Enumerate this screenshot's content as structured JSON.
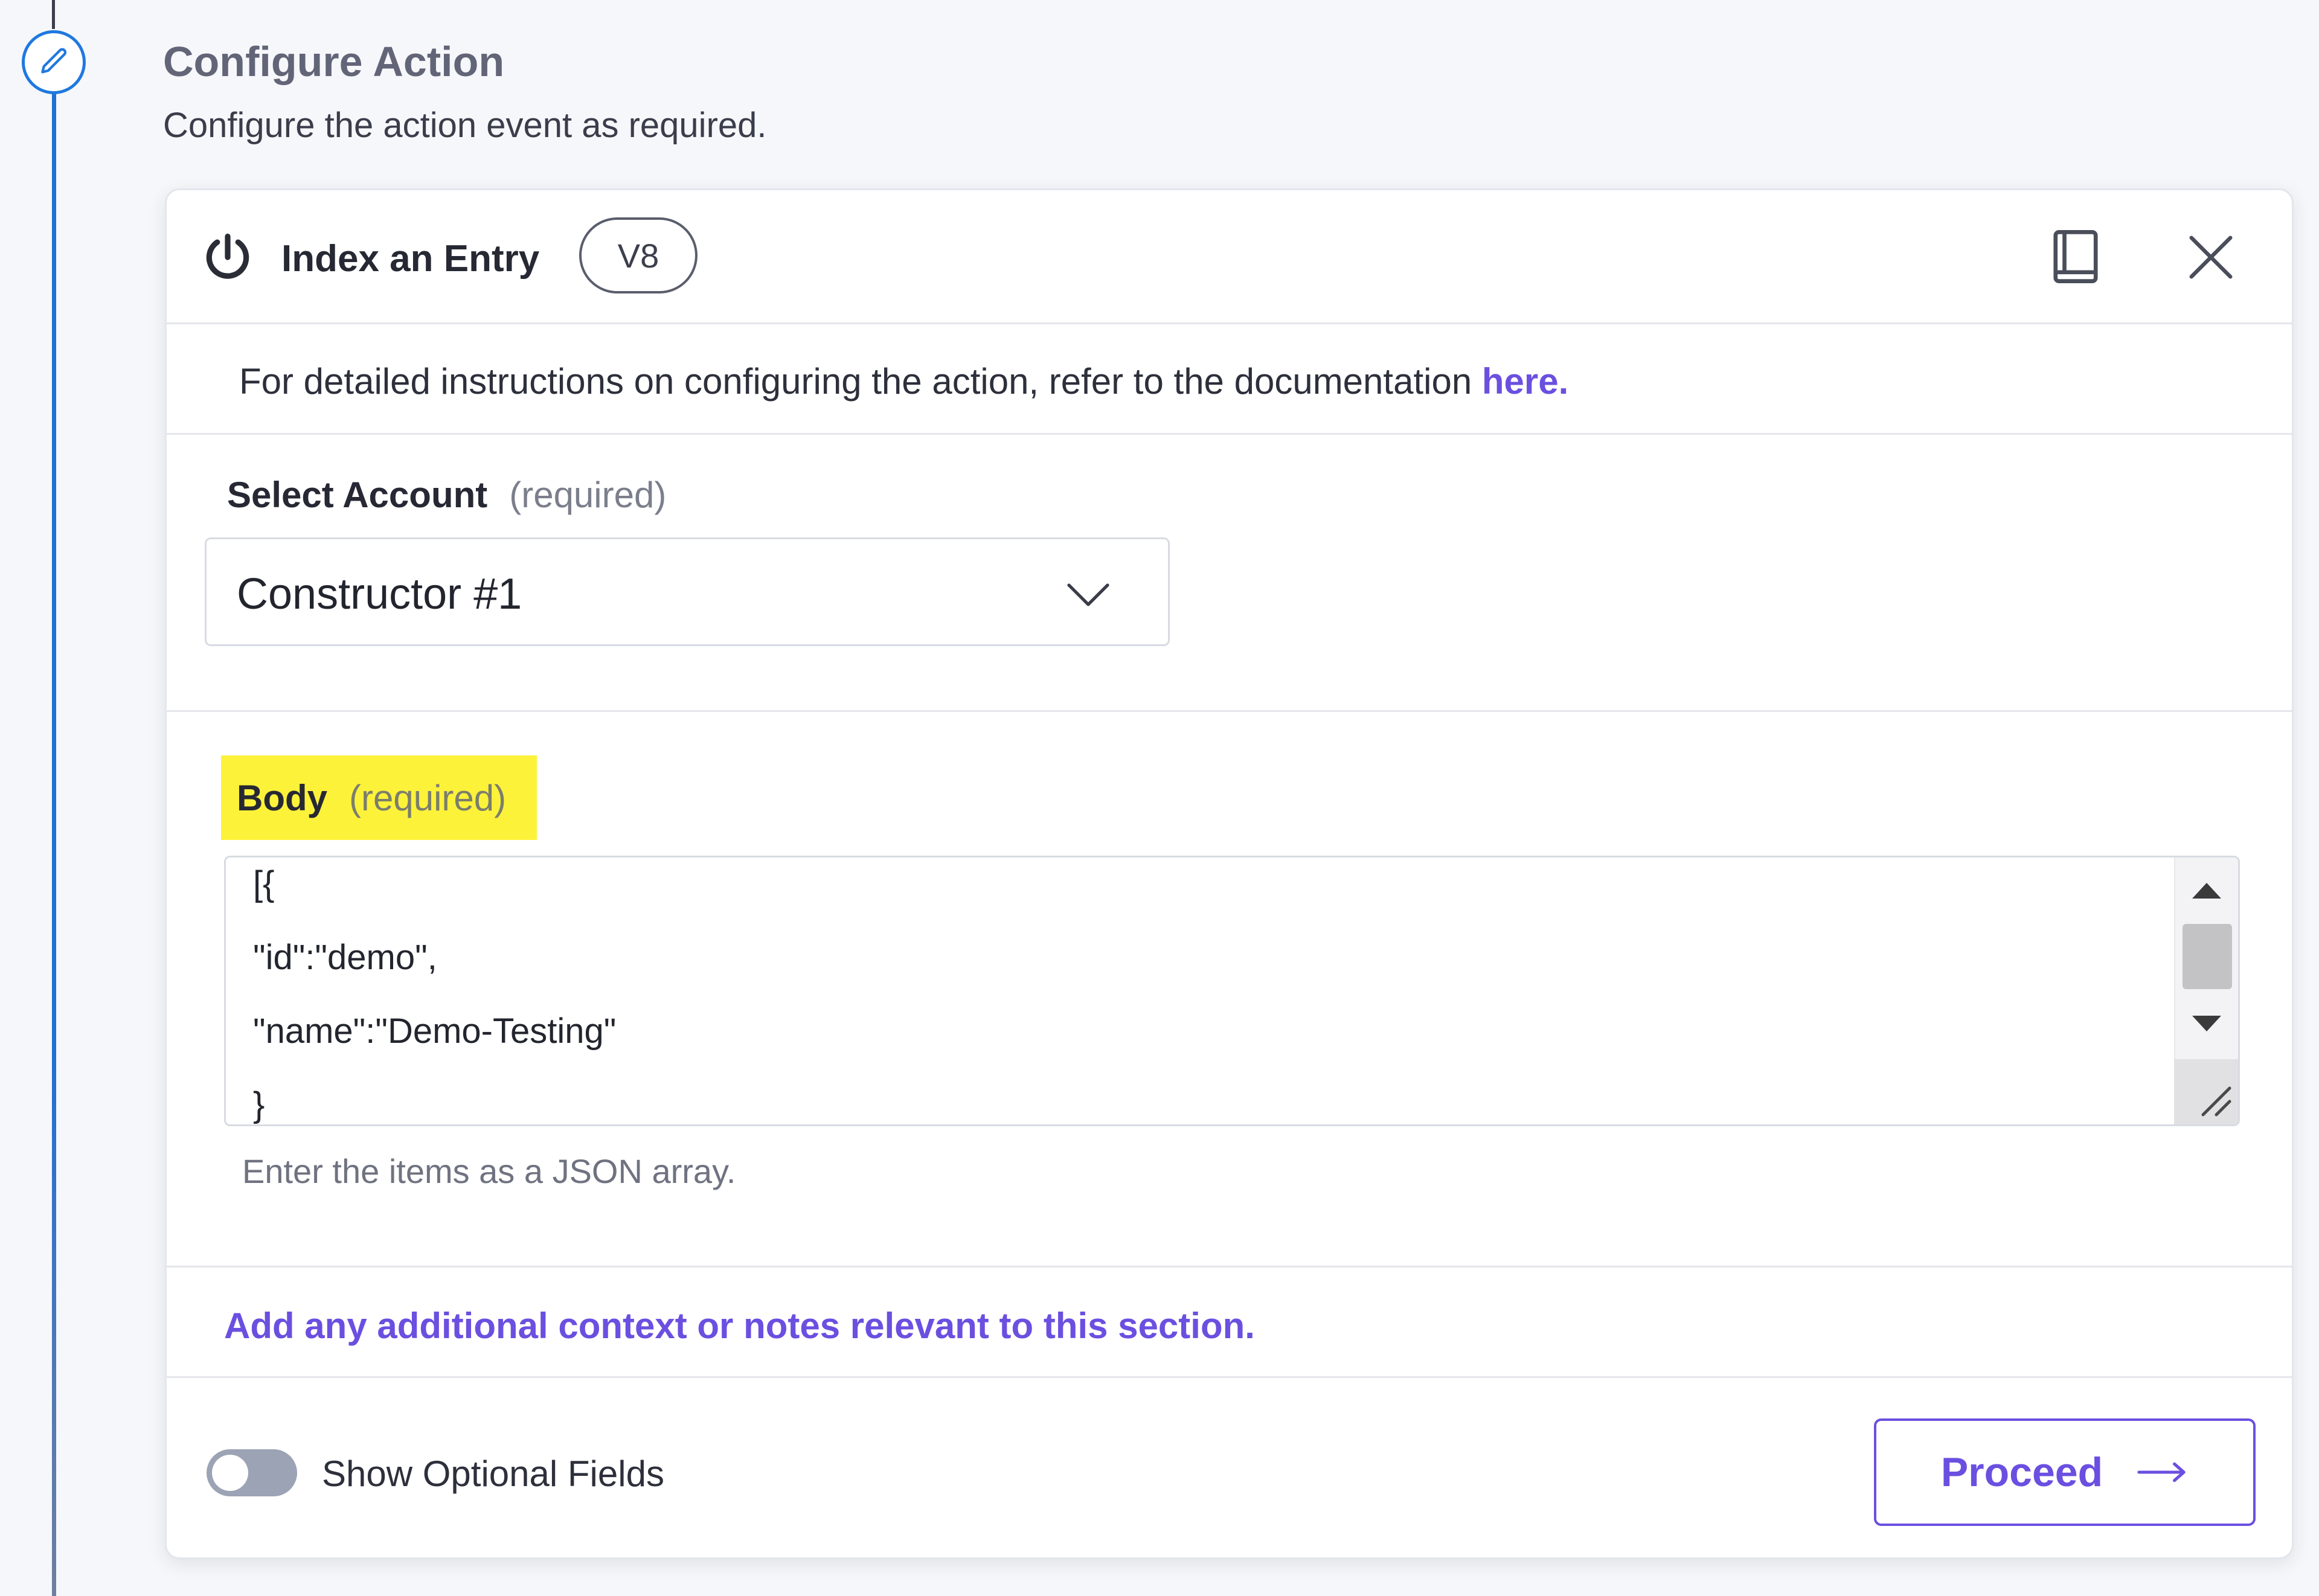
{
  "section": {
    "title": "Configure Action",
    "subtitle": "Configure the action event as required."
  },
  "action": {
    "name": "Index an Entry",
    "version": "V8"
  },
  "info": {
    "text": "For detailed instructions on configuring the action, refer to the documentation ",
    "link_label": "here."
  },
  "account": {
    "label": "Select Account",
    "required_text": "(required)",
    "selected_value": "Constructor #1"
  },
  "body": {
    "label": "Body",
    "required_text": "(required)",
    "lines": [
      "[{",
      "\"id\":\"demo\",",
      "\"name\":\"Demo-Testing\"",
      "}"
    ],
    "helper_text": "Enter the items as a JSON array."
  },
  "notes": {
    "link_label": "Add any additional context or notes relevant to this section."
  },
  "footer": {
    "toggle_label": "Show Optional Fields",
    "toggle_on": false,
    "proceed_label": "Proceed"
  },
  "colors": {
    "accent": "#6b4fe0",
    "timeline": "#1f6fd6",
    "highlight": "#fdf23a"
  }
}
